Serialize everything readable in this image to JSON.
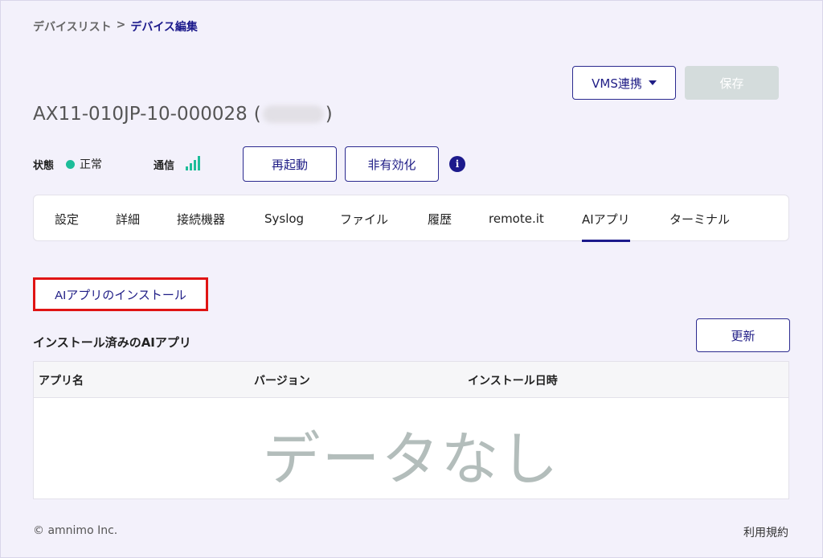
{
  "breadcrumb": {
    "parent": "デバイスリスト",
    "separator": ">",
    "current": "デバイス編集"
  },
  "header": {
    "vms_label": "VMS連携",
    "save_label": "保存"
  },
  "device": {
    "id": "AX11-010JP-10-000028",
    "open_paren": "(",
    "close_paren": ")"
  },
  "status": {
    "state_label": "状態",
    "state_value": "正常",
    "state_color": "#1dbd99",
    "comm_label": "通信",
    "signal_icon": "signal-bars-icon",
    "reboot_label": "再起動",
    "disable_label": "非有効化",
    "info_icon": "i"
  },
  "tabs": [
    {
      "label": "設定"
    },
    {
      "label": "詳細"
    },
    {
      "label": "接続機器"
    },
    {
      "label": "Syslog"
    },
    {
      "label": "ファイル"
    },
    {
      "label": "履歴"
    },
    {
      "label": "remote.it"
    },
    {
      "label": "AIアプリ",
      "active": true
    },
    {
      "label": "ターミナル"
    }
  ],
  "ai_app": {
    "install_label": "AIアプリのインストール",
    "section_title": "インストール済みのAIアプリ",
    "refresh_label": "更新",
    "columns": [
      "アプリ名",
      "バージョン",
      "インストール日時"
    ],
    "empty_text": "データなし"
  },
  "footer": {
    "copyright": "© amnimo Inc.",
    "terms": "利用規約"
  },
  "colors": {
    "accent": "#1c1a8c",
    "highlight_border": "#e01414",
    "page_bg": "#f3f1fb"
  }
}
